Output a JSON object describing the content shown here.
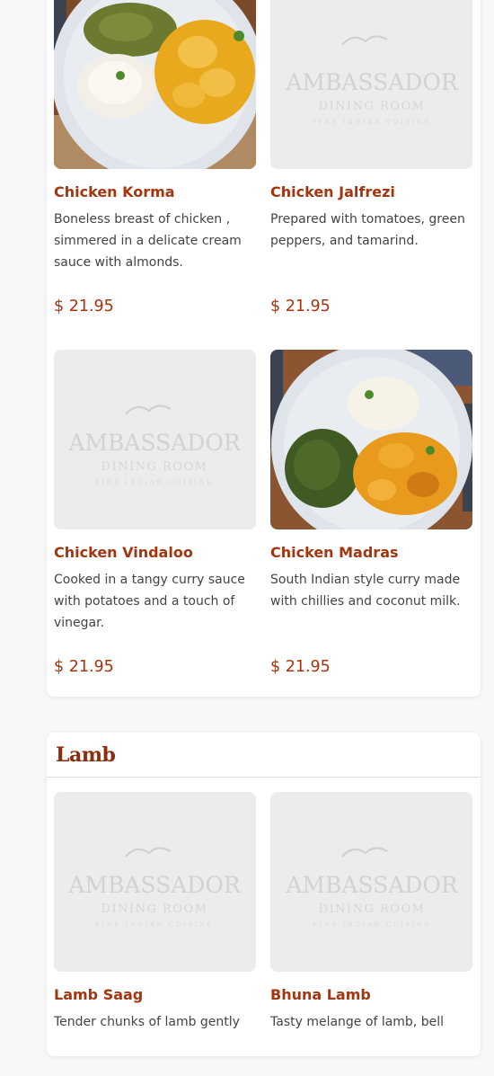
{
  "placeholder_logo": {
    "line1": "AMBASSADOR",
    "line2": "DINING ROOM",
    "line3": "FINE INDIAN CUISINE"
  },
  "colors": {
    "accent": "#a3350f",
    "heading": "#8b2e0f",
    "text": "#444444"
  },
  "chicken_items": [
    {
      "name": "Chicken Korma",
      "description": "Boneless breast of chicken , simmered in a delicate cream sauce with almonds.",
      "price": "$ 21.95",
      "image": "dish-photo"
    },
    {
      "name": "Chicken Jalfrezi",
      "description": "Prepared with tomatoes, green peppers, and tamarind.",
      "price": "$ 21.95",
      "image": "placeholder-logo"
    },
    {
      "name": "Chicken Vindaloo",
      "description": "Cooked in a tangy curry sauce with potatoes and a touch of vinegar.",
      "price": "$ 21.95",
      "image": "placeholder-logo"
    },
    {
      "name": "Chicken Madras",
      "description": "South Indian style curry made with chillies and coconut milk.",
      "price": "$ 21.95",
      "image": "dish-photo"
    }
  ],
  "lamb_section": {
    "title": "Lamb",
    "items": [
      {
        "name": "Lamb Saag",
        "description": "Tender chunks of lamb gently",
        "image": "placeholder-logo"
      },
      {
        "name": "Bhuna Lamb",
        "description": "Tasty melange of lamb, bell",
        "image": "placeholder-logo"
      }
    ]
  }
}
